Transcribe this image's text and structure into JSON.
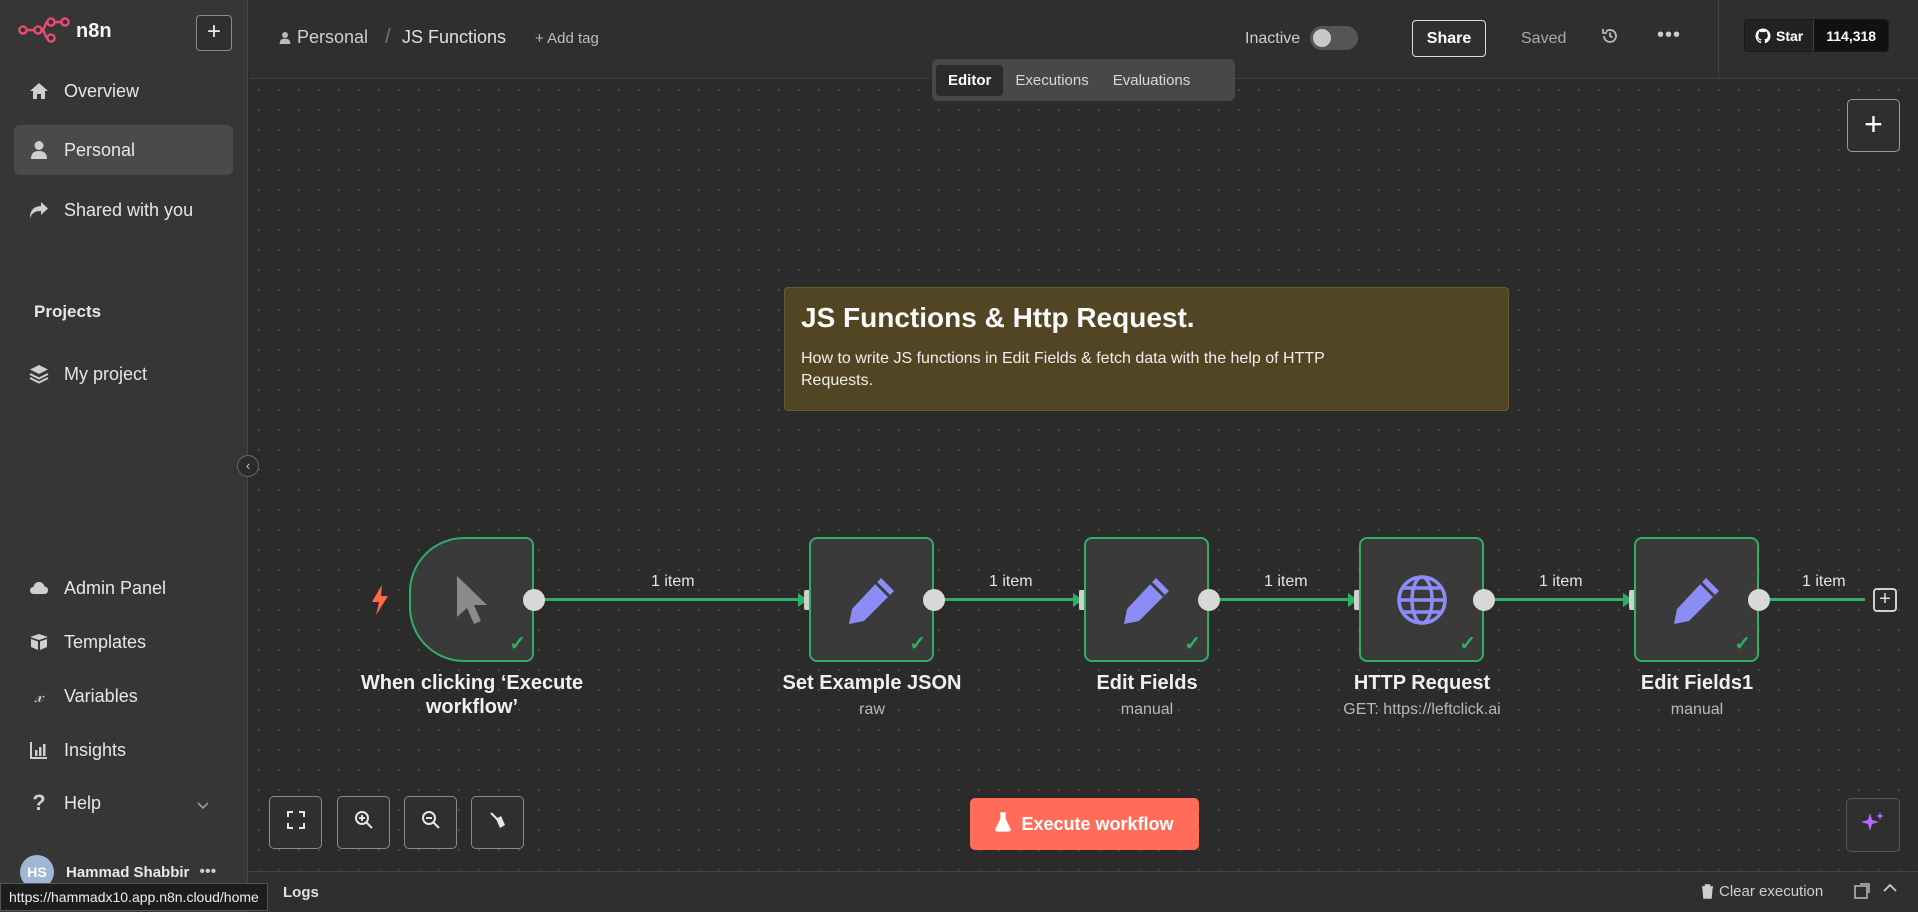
{
  "app": {
    "name": "n8n"
  },
  "sidebar": {
    "items": [
      {
        "label": "Overview",
        "icon": "home-icon"
      },
      {
        "label": "Personal",
        "icon": "user-icon",
        "active": true
      },
      {
        "label": "Shared with you",
        "icon": "share-icon"
      }
    ],
    "projects_title": "Projects",
    "projects": [
      {
        "label": "My project",
        "icon": "layers-icon"
      }
    ],
    "bottom_items": [
      {
        "label": "Admin Panel",
        "icon": "cloud-icon"
      },
      {
        "label": "Templates",
        "icon": "box-icon"
      },
      {
        "label": "Variables",
        "icon": "variable-icon"
      },
      {
        "label": "Insights",
        "icon": "chart-icon"
      },
      {
        "label": "Help",
        "icon": "help-icon"
      }
    ],
    "user": {
      "initials": "HS",
      "name": "Hammad Shabbir"
    }
  },
  "header": {
    "breadcrumb_project": "Personal",
    "breadcrumb_workflow": "JS Functions",
    "add_tag": "+ Add tag",
    "status_label": "Inactive",
    "share_label": "Share",
    "saved_label": "Saved",
    "github_star": "Star",
    "github_count": "114,318"
  },
  "tabs": [
    {
      "label": "Editor",
      "active": true
    },
    {
      "label": "Executions"
    },
    {
      "label": "Evaluations"
    }
  ],
  "sticky": {
    "title": "JS Functions & Http Request.",
    "body": "How to write JS functions in Edit Fields & fetch data with the help of HTTP Requests."
  },
  "nodes": [
    {
      "label": "When clicking ‘Execute workflow’",
      "sub": "",
      "icon": "cursor-icon"
    },
    {
      "label": "Set Example JSON",
      "sub": "raw",
      "icon": "pencil-icon"
    },
    {
      "label": "Edit Fields",
      "sub": "manual",
      "icon": "pencil-icon"
    },
    {
      "label": "HTTP Request",
      "sub": "GET: https://leftclick.ai",
      "icon": "globe-icon"
    },
    {
      "label": "Edit Fields1",
      "sub": "manual",
      "icon": "pencil-icon"
    }
  ],
  "edge_labels": [
    "1 item",
    "1 item",
    "1 item",
    "1 item",
    "1 item"
  ],
  "execute_label": "Execute workflow",
  "bottom": {
    "logs_label": "Logs",
    "clear_label": "Clear execution"
  },
  "status_url": "https://hammadx10.app.n8n.cloud/home",
  "colors": {
    "accent": "#ff6d5a",
    "success": "#2fae65",
    "node_icon": "#8c8cf5"
  }
}
